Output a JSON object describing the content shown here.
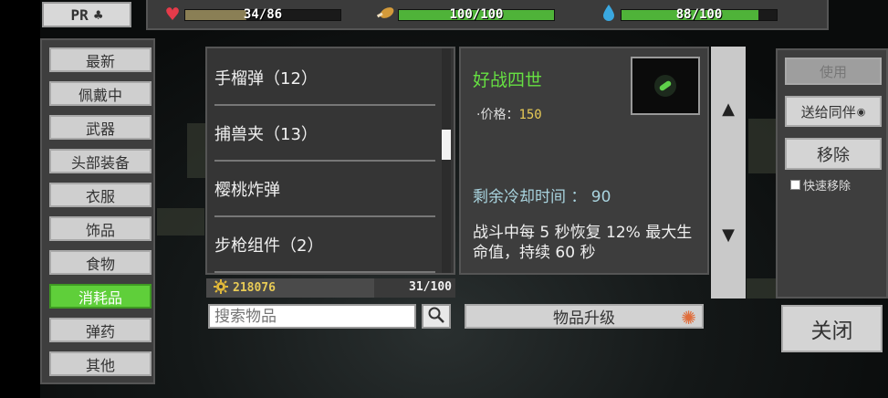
{
  "profile": {
    "label": "PR",
    "icon": "club-icon"
  },
  "stats": {
    "health": {
      "icon": "heart-icon",
      "text": "34/86",
      "fraction": 0.395,
      "color": "#8a7f55"
    },
    "food": {
      "icon": "meat-icon",
      "text": "100/100",
      "fraction": 1.0,
      "color": "#4fb339"
    },
    "water": {
      "icon": "water-drop-icon",
      "text": "88/100",
      "fraction": 0.88,
      "color": "#4fb339"
    }
  },
  "categories": [
    {
      "label": "最新",
      "active": false
    },
    {
      "label": "佩戴中",
      "active": false
    },
    {
      "label": "武器",
      "active": false
    },
    {
      "label": "头部装备",
      "active": false
    },
    {
      "label": "衣服",
      "active": false
    },
    {
      "label": "饰品",
      "active": false
    },
    {
      "label": "食物",
      "active": false
    },
    {
      "label": "消耗品",
      "active": true
    },
    {
      "label": "弹药",
      "active": false
    },
    {
      "label": "其他",
      "active": false
    }
  ],
  "items": [
    {
      "label": "手榴弹（12）"
    },
    {
      "label": "捕兽夹（13）"
    },
    {
      "label": "樱桃炸弹"
    },
    {
      "label": "步枪组件（2）"
    }
  ],
  "list_scroll_fraction": 0.42,
  "gold": {
    "icon": "gear-coin-icon",
    "value": "218076"
  },
  "capacity": "31/100",
  "search": {
    "placeholder": "搜索物品"
  },
  "detail": {
    "name": "好战四世",
    "price_label": "·价格：",
    "price_value": "150",
    "cooldown": "剩余冷却时间 ： 90",
    "description": "战斗中每 5 秒恢复 12% 最大生命值，持续 60 秒",
    "colors": {
      "name": "#66e042",
      "price": "#e8cb56",
      "cooldown": "#a9d4df"
    }
  },
  "upgrade_label": "物品升级",
  "actions": {
    "use_label": "使用",
    "gift_label": "送给同伴",
    "remove_label": "移除",
    "quick_remove_label": "快速移除"
  },
  "close_label": "关闭"
}
